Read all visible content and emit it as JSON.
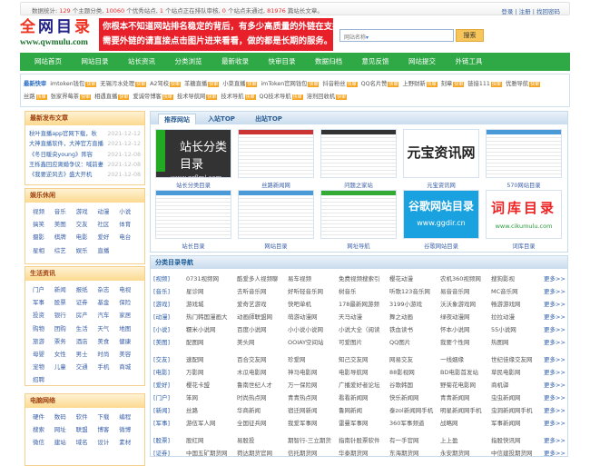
{
  "topbar": {
    "stats_prefix": "数据统计:",
    "topics": "129",
    "topics_label": "个主题分类,",
    "sites": "10060",
    "sites_label": "个优秀站点,",
    "pending": "1",
    "pending_label": "个站点正在排队审核,",
    "rejected": "0",
    "rejected_label": "个站点未通过,",
    "articles": "81976",
    "articles_label": "篇站长文章。",
    "login": "登录",
    "register": "注册",
    "forgot": "找回密码"
  },
  "logo": {
    "text": "全网目录",
    "url": "www.qwmulu.com"
  },
  "banner": {
    "line1": "你根本不知道网站排名稳定的背后，有多少高质量的外链在支撑!",
    "line2": "需要外链的请直接点击图片进来看看，做的都是长期的服务。"
  },
  "search": {
    "placeholder": "网站名称",
    "button": "搜索"
  },
  "nav": [
    "网站首页",
    "网站目录",
    "站长资讯",
    "分类浏览",
    "最新收录",
    "快审目录",
    "数据归档",
    "意见反馈",
    "网站提交",
    "外链工具"
  ],
  "latest": {
    "label": "最新快审",
    "tag": "快审",
    "items": [
      "imtoken钱包",
      "无锡污水处理",
      "A2驾校",
      "羊糖直播",
      "小菜直播",
      "imToken官网钱包",
      "抖音粉丝",
      "QQ名片赞",
      "上野财新",
      "刻章",
      "链接111",
      "优雅导航",
      "丝路",
      "张家界莓茶",
      "相遇直播",
      "爱诚帝博客",
      "技术导航网",
      "技术导航",
      "QQ技术导航",
      "溶剂回收机"
    ]
  },
  "articles": {
    "title": "最新发布文章",
    "items": [
      {
        "t": "秋叶直播app官网下载，秋",
        "d": "2021-12-12"
      },
      {
        "t": "大神直播软件，大神官方直播",
        "d": "2021-12-12"
      },
      {
        "t": "《冬日暖央young》阵容",
        "d": "2021-12-08"
      },
      {
        "t": "王栎鑫回应离婚争议：喊前妻",
        "d": "2021-12-08"
      },
      {
        "t": "《我要逆风去》盛大开机",
        "d": "2021-12-08"
      }
    ]
  },
  "sections": [
    {
      "title": "娱乐休闲",
      "items": [
        "视频",
        "音乐",
        "游戏",
        "动漫",
        "小说",
        "搞笑",
        "美图",
        "交友",
        "社区",
        "体育",
        "摄影",
        "棋牌",
        "电影",
        "爱好",
        "电台",
        "星相",
        "综艺",
        "娱乐",
        "直播"
      ]
    },
    {
      "title": "生活资讯",
      "items": [
        "门户",
        "新闻",
        "报纸",
        "杂志",
        "电视",
        "军事",
        "股票",
        "证券",
        "基金",
        "保险",
        "投资",
        "银行",
        "房产",
        "汽车",
        "家居",
        "购物",
        "团购",
        "生活",
        "天气",
        "地图",
        "旅游",
        "票务",
        "酒店",
        "美食",
        "健康",
        "母婴",
        "女性",
        "男士",
        "时尚",
        "美容",
        "宠物",
        "儿童",
        "交通",
        "手机",
        "商城",
        "招聘"
      ]
    },
    {
      "title": "电脑网络",
      "items": [
        "硬件",
        "数码",
        "软件",
        "下载",
        "编程",
        "搜索",
        "网址",
        "联盟",
        "博客",
        "微博",
        "微信",
        "建站",
        "域名",
        "设计",
        "素材"
      ]
    }
  ],
  "tabs": [
    "推荐网站",
    "入站TOP",
    "出站TOP"
  ],
  "recommended": [
    {
      "name": "站长分类目录",
      "img": "站长分类目录",
      "img2": "www.zzflml.com"
    },
    {
      "name": "丝路新闻网"
    },
    {
      "name": "问题之家站"
    },
    {
      "name": "元宝资讯网",
      "img": "元宝资讯网"
    },
    {
      "name": "570网站目录"
    },
    {
      "name": "站长目录"
    },
    {
      "name": "网站目录"
    },
    {
      "name": "网址导航"
    },
    {
      "name": "谷歌网站目录",
      "img": "谷歌网站目录",
      "img2": "www.ggdir.cn"
    },
    {
      "name": "词库目录",
      "img": "词库目录",
      "img2": "www.cikumulu.com"
    }
  ],
  "categories": {
    "title": "分类目录导航",
    "more": "更多>>",
    "rows": [
      {
        "cat": "[视频]",
        "sites": [
          "0731视频网",
          "酷爱多人视频聊",
          "易车视频",
          "免费视频搜索引",
          "樱花动漫",
          "农机360视频网",
          "搜狗影视"
        ]
      },
      {
        "cat": "[音乐]",
        "sites": [
          "星诊网",
          "去听音乐网",
          "好听轻音乐网",
          "树音乐",
          "听歌123音乐网",
          "易音音乐网",
          "MC音乐网"
        ]
      },
      {
        "cat": "[游戏]",
        "sites": [
          "游戏城",
          "爱奇艺游戏",
          "快吧单机",
          "178最新网游频",
          "3199小游戏",
          "沃沃象游戏网",
          "畅游游戏网"
        ]
      },
      {
        "cat": "[动漫]",
        "sites": [
          "热门韩国漫画大",
          "动画師联盟网",
          "萌游动漫网",
          "天马动漫",
          "舞之动画",
          "绿夜动漫网",
          "拉拉动漫"
        ]
      },
      {
        "cat": "[小说]",
        "sites": [
          "糯米小说网",
          "百度小说网",
          "小小说小说网",
          "小说大全（阅读",
          "铁血读书",
          "怀本小说网",
          "55小说网"
        ]
      },
      {
        "cat": "[美图]",
        "sites": [
          "配图网",
          "美头网",
          "OOIAY空间站",
          "可爱图片",
          "QQ图片",
          "我要个性网",
          "热图网"
        ]
      },
      {
        "cat": "[交友]",
        "sites": [
          "速配网",
          "百合交友网",
          "珍爱网",
          "知己交友网",
          "网易交友",
          "一线姻缘",
          "世纪佳缘交友网"
        ]
      },
      {
        "cat": "[电影]",
        "sites": [
          "万影网",
          "木瓜电影网",
          "神马电影网",
          "电影导航网",
          "88影视网",
          "BD电影首发站",
          "草民电影网"
        ]
      },
      {
        "cat": "[爱好]",
        "sites": [
          "樱花卡盟",
          "鲁南世纪人才",
          "万一保险网",
          "广播爱好者论坛",
          "谷歌韩国",
          "野菊花电影网",
          "商机驿"
        ]
      },
      {
        "cat": "[门户]",
        "sites": [
          "笨网",
          "时尚热点网",
          "青青热点网",
          "看看新闻网",
          "快乐新闻网",
          "青青新闻网",
          "虫虫新闻网"
        ]
      },
      {
        "cat": "[新闻]",
        "sites": [
          "丝路",
          "华商新闻",
          "宿迁网新闻",
          "鲁网新闻",
          "泰zol新闻网手机",
          "明星新闻网手机",
          "虫洞新闻网手机"
        ]
      },
      {
        "cat": "[军事]",
        "sites": [
          "游伍军人网",
          "全国征兵网",
          "我爱军事网",
          "雷曼军事网",
          "360军事频道",
          "战略网",
          "军事新闻网"
        ]
      },
      {
        "cat": "[股票]",
        "sites": [
          "股红网",
          "易股投",
          "期智行-三立期货",
          "指南针股票软件",
          "有一手官网",
          "上上盈",
          "指股快讯网"
        ]
      },
      {
        "cat": "[证券]",
        "sites": [
          "中国五矿期货网",
          "荷达期货官网",
          "信托期货网",
          "华泰期货网",
          "东海期货网",
          "永安期货网",
          "中信建投期货网"
        ]
      }
    ]
  }
}
